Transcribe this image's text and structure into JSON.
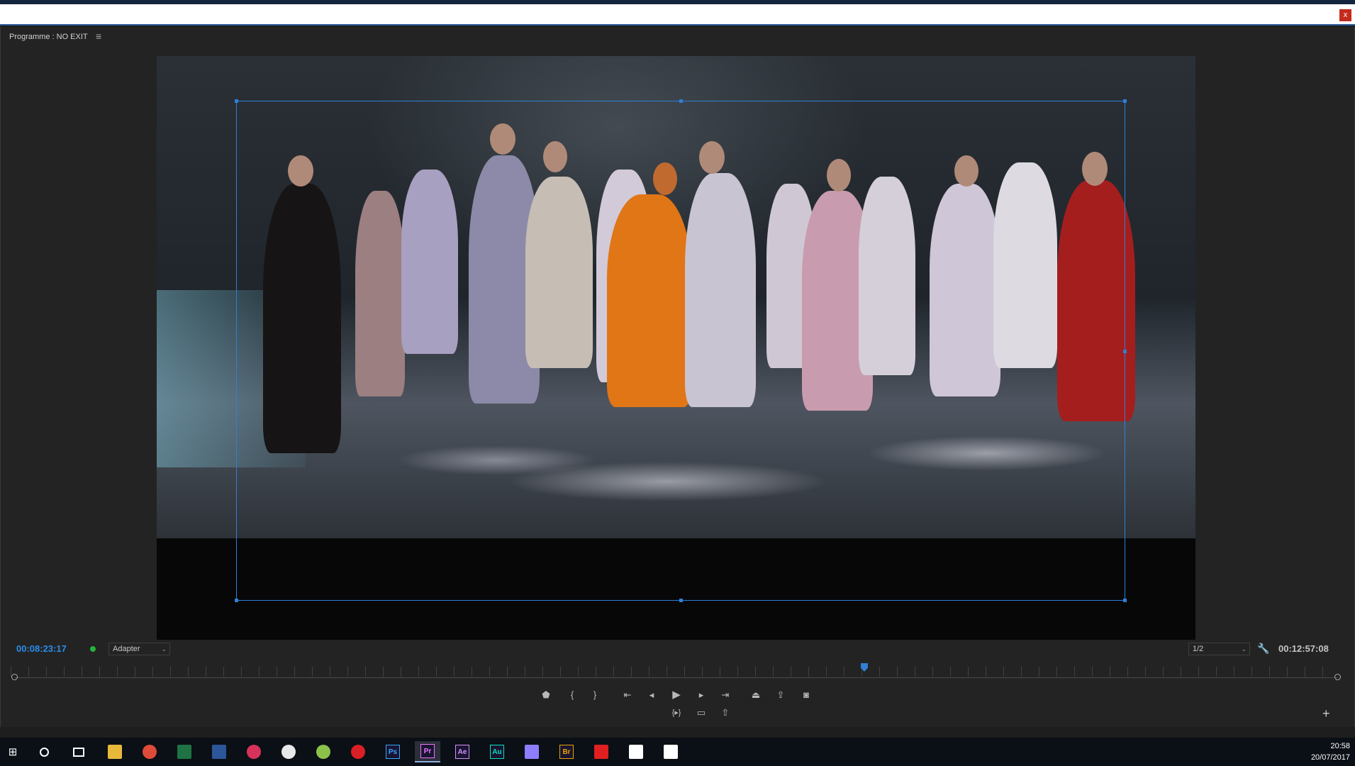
{
  "panel": {
    "title": "Programme : NO EXIT",
    "menu_icon": "hamburger-icon"
  },
  "window": {
    "close_label": "x"
  },
  "monitor": {
    "current_timecode": "00:08:23:17",
    "fit_option": "Adapter",
    "resolution_option": "1/2",
    "total_duration": "00:12:57:08",
    "playhead_position_fraction": 0.642
  },
  "transport": {
    "row1": [
      "marker-icon",
      "mark-in-icon",
      "mark-out-icon",
      "go-to-in-icon",
      "step-back-icon",
      "play-icon",
      "step-forward-icon",
      "go-to-out-icon",
      "lift-icon",
      "extract-icon",
      "export-frame-icon"
    ],
    "row2": [
      "play-in-to-out-icon",
      "safe-margins-icon",
      "export-icon"
    ],
    "add_label": "+"
  },
  "taskbar": {
    "apps": [
      {
        "name": "file-explorer",
        "label": "",
        "color": "#e8b83a"
      },
      {
        "name": "chrome",
        "label": "",
        "color": "#dd4b39"
      },
      {
        "name": "excel",
        "label": "",
        "color": "#1f7244"
      },
      {
        "name": "word",
        "label": "",
        "color": "#2b579a"
      },
      {
        "name": "davinci",
        "label": "",
        "color": "#d8325a"
      },
      {
        "name": "navigator",
        "label": "",
        "color": "#e8e8e8"
      },
      {
        "name": "android-app",
        "label": "",
        "color": "#8bc34a"
      },
      {
        "name": "creative-cloud",
        "label": "",
        "color": "#da1f26"
      },
      {
        "name": "photoshop",
        "label": "Ps",
        "color": "#31a8ff"
      },
      {
        "name": "premiere",
        "label": "Pr",
        "color": "#ea77ff"
      },
      {
        "name": "after-effects",
        "label": "Ae",
        "color": "#d291ff"
      },
      {
        "name": "audition",
        "label": "Au",
        "color": "#00e4bb"
      },
      {
        "name": "media-encoder",
        "label": "",
        "color": "#8f7dff"
      },
      {
        "name": "bridge",
        "label": "Br",
        "color": "#e8a200"
      },
      {
        "name": "acrobat",
        "label": "",
        "color": "#e02020"
      },
      {
        "name": "calculator",
        "label": "",
        "color": "#ffffff"
      },
      {
        "name": "mail",
        "label": "",
        "color": "#ffffff"
      }
    ],
    "active_app": "premiere",
    "time": "20:58",
    "date": "20/07/2017"
  }
}
